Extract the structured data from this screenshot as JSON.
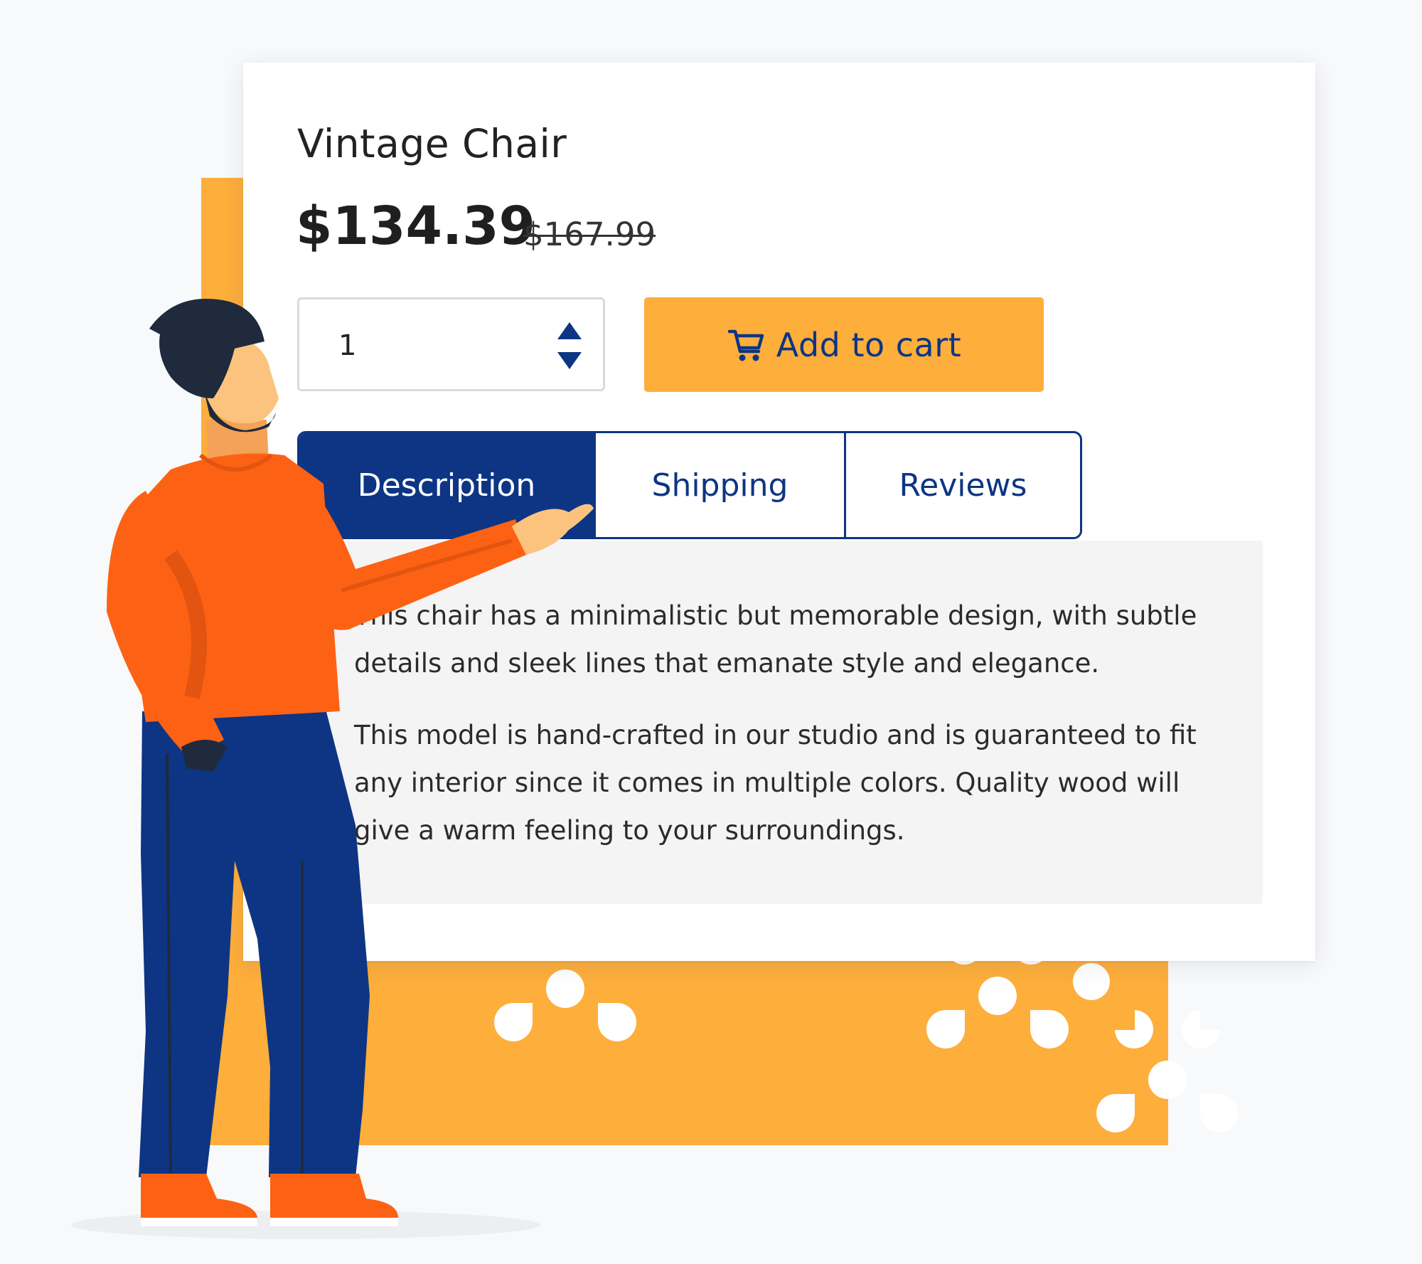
{
  "product": {
    "title": "Vintage Chair",
    "price": "$134.39",
    "original_price": "$167.99"
  },
  "quantity": {
    "value": "1",
    "stepper_icon": "up-down-arrows-icon"
  },
  "cart": {
    "label": "Add to cart",
    "icon": "shopping-cart-icon"
  },
  "tabs": [
    {
      "label": "Description",
      "active": true
    },
    {
      "label": "Shipping",
      "active": false
    },
    {
      "label": "Reviews",
      "active": false
    }
  ],
  "description": {
    "paragraph_1": "This chair has a minimalistic but memorable design, with subtle details and sleek lines that emanate style and elegance.",
    "paragraph_2": "This model is hand-crafted in our studio and is guaranteed to fit any interior since it comes in multiple colors. Quality wood will give a warm feeling to your surroundings."
  },
  "colors": {
    "accent_orange": "#fdae3b",
    "brand_blue": "#0d3584",
    "panel_gray": "#f4f4f5",
    "shirt_orange": "#fd6214"
  }
}
